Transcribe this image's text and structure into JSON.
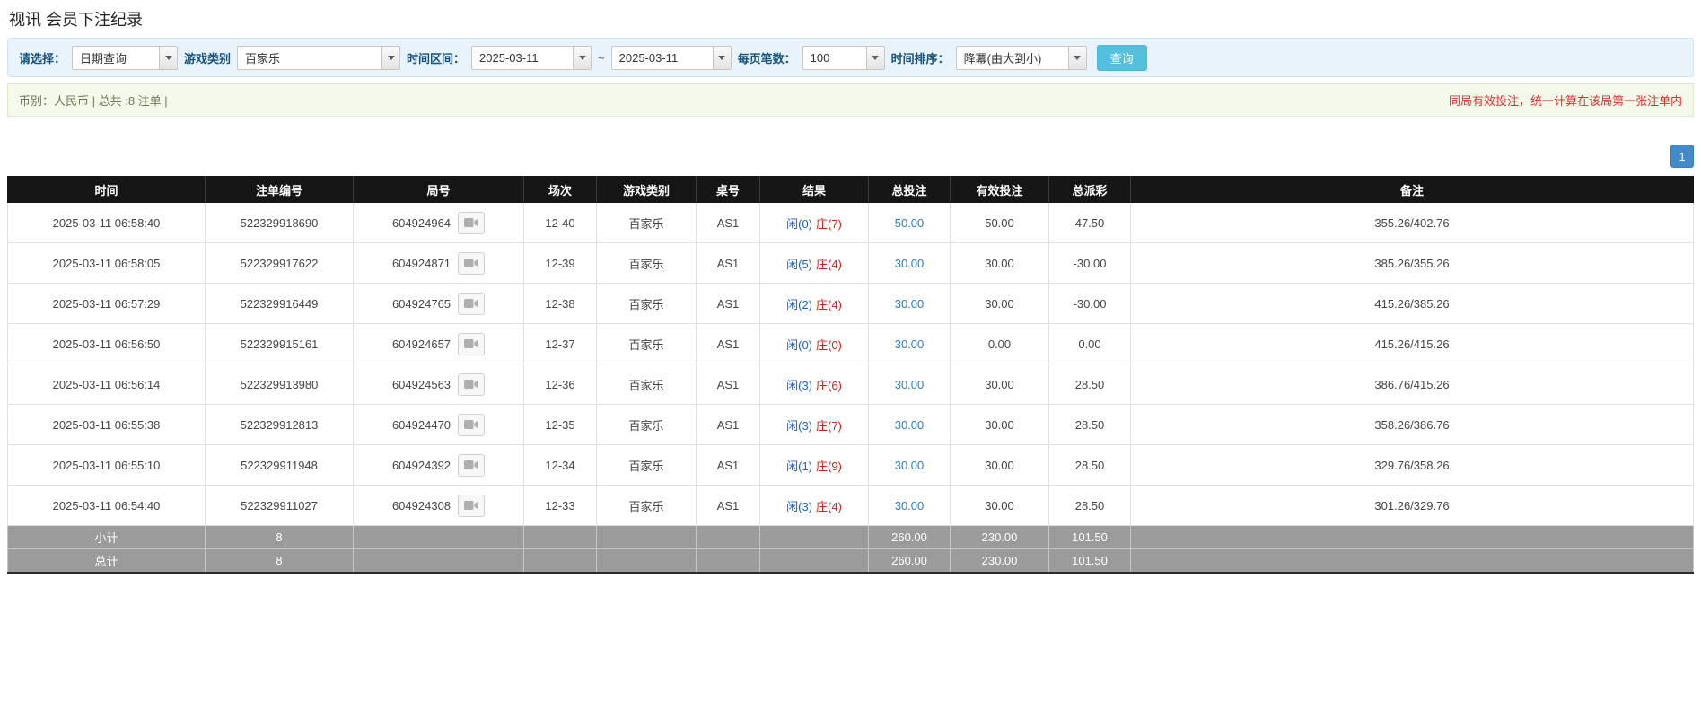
{
  "page": {
    "title": "视讯 会员下注纪录"
  },
  "filters": {
    "select_label": "请选择：",
    "select_value": "日期查询",
    "game_type_label": "游戏类别",
    "game_type_value": "百家乐",
    "time_range_label": "时间区间：",
    "time_from": "2025-03-11",
    "time_separator": "~",
    "time_to": "2025-03-11",
    "page_size_label": "每页笔数：",
    "page_size_value": "100",
    "sort_label": "时间排序：",
    "sort_value": "降冪(由大到小)",
    "search_button_label": "查询"
  },
  "summary": {
    "info_text": "币别：人民币 | 总共 :8 注单 |",
    "note_text": "同局有效投注，统一计算在该局第一张注单内"
  },
  "pagination": {
    "page": "1"
  },
  "table": {
    "headers": [
      "时间",
      "注单编号",
      "局号",
      "场次",
      "游戏类别",
      "桌号",
      "结果",
      "总投注",
      "有效投注",
      "总派彩",
      "备注"
    ],
    "rows": [
      {
        "time": "2025-03-11 06:58:40",
        "bet_id": "522329918690",
        "round_id": "604924964",
        "session": "12-40",
        "game": "百家乐",
        "table_no": "AS1",
        "result_player": "闲(0)",
        "result_banker": "庄(7)",
        "total_bet": "50.00",
        "valid_bet": "50.00",
        "payout": "47.50",
        "note": "355.26/402.76"
      },
      {
        "time": "2025-03-11 06:58:05",
        "bet_id": "522329917622",
        "round_id": "604924871",
        "session": "12-39",
        "game": "百家乐",
        "table_no": "AS1",
        "result_player": "闲(5)",
        "result_banker": "庄(4)",
        "total_bet": "30.00",
        "valid_bet": "30.00",
        "payout": "-30.00",
        "note": "385.26/355.26"
      },
      {
        "time": "2025-03-11 06:57:29",
        "bet_id": "522329916449",
        "round_id": "604924765",
        "session": "12-38",
        "game": "百家乐",
        "table_no": "AS1",
        "result_player": "闲(2)",
        "result_banker": "庄(4)",
        "total_bet": "30.00",
        "valid_bet": "30.00",
        "payout": "-30.00",
        "note": "415.26/385.26"
      },
      {
        "time": "2025-03-11 06:56:50",
        "bet_id": "522329915161",
        "round_id": "604924657",
        "session": "12-37",
        "game": "百家乐",
        "table_no": "AS1",
        "result_player": "闲(0)",
        "result_banker": "庄(0)",
        "total_bet": "30.00",
        "valid_bet": "0.00",
        "payout": "0.00",
        "note": "415.26/415.26"
      },
      {
        "time": "2025-03-11 06:56:14",
        "bet_id": "522329913980",
        "round_id": "604924563",
        "session": "12-36",
        "game": "百家乐",
        "table_no": "AS1",
        "result_player": "闲(3)",
        "result_banker": "庄(6)",
        "total_bet": "30.00",
        "valid_bet": "30.00",
        "payout": "28.50",
        "note": "386.76/415.26"
      },
      {
        "time": "2025-03-11 06:55:38",
        "bet_id": "522329912813",
        "round_id": "604924470",
        "session": "12-35",
        "game": "百家乐",
        "table_no": "AS1",
        "result_player": "闲(3)",
        "result_banker": "庄(7)",
        "total_bet": "30.00",
        "valid_bet": "30.00",
        "payout": "28.50",
        "note": "358.26/386.76"
      },
      {
        "time": "2025-03-11 06:55:10",
        "bet_id": "522329911948",
        "round_id": "604924392",
        "session": "12-34",
        "game": "百家乐",
        "table_no": "AS1",
        "result_player": "闲(1)",
        "result_banker": "庄(9)",
        "total_bet": "30.00",
        "valid_bet": "30.00",
        "payout": "28.50",
        "note": "329.76/358.26"
      },
      {
        "time": "2025-03-11 06:54:40",
        "bet_id": "522329911027",
        "round_id": "604924308",
        "session": "12-33",
        "game": "百家乐",
        "table_no": "AS1",
        "result_player": "闲(3)",
        "result_banker": "庄(4)",
        "total_bet": "30.00",
        "valid_bet": "30.00",
        "payout": "28.50",
        "note": "301.26/329.76"
      }
    ],
    "subtotal": {
      "label": "小计",
      "count": "8",
      "total_bet": "260.00",
      "valid_bet": "230.00",
      "payout": "101.50"
    },
    "total": {
      "label": "总计",
      "count": "8",
      "total_bet": "260.00",
      "valid_bet": "230.00",
      "payout": "101.50"
    }
  }
}
